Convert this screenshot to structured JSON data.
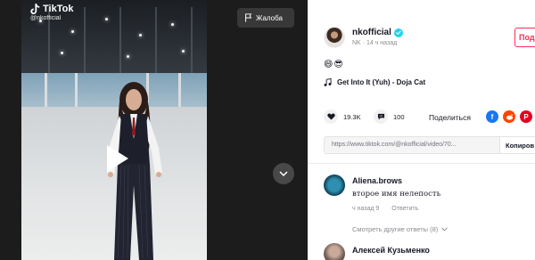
{
  "video": {
    "brand": "TikTok",
    "watermark_handle": "@nkofficial",
    "report_label": "Жалоба"
  },
  "author": {
    "username": "nkofficial",
    "display_name": "NK",
    "separator": "·",
    "posted_ago": "14 ч назад",
    "follow_label": "Под"
  },
  "post": {
    "caption_emoji": "😄😎",
    "music": "Get Into It (Yuh) - Doja Cat"
  },
  "stats": {
    "likes": "19.3K",
    "comments": "100",
    "share_label": "Поделиться"
  },
  "share_icons": [
    "facebook-icon",
    "reddit-icon",
    "pinterest-icon"
  ],
  "link": {
    "url": "https://www.tiktok.com/@nkofficial/video/70...",
    "copy_label": "Копиров"
  },
  "comments": [
    {
      "author": "Aliena.brows",
      "text": "второе имя нелепость",
      "time": "ч назад 9",
      "reply_label": "Ответить",
      "more_replies": "Смотреть другие ответы (8)"
    },
    {
      "author": "Алексей Кузьменко"
    }
  ],
  "colors": {
    "accent": "#fe2c55",
    "verified": "#20d5ec",
    "facebook": "#1877f2",
    "reddit": "#ff4500",
    "pinterest": "#e60023"
  }
}
